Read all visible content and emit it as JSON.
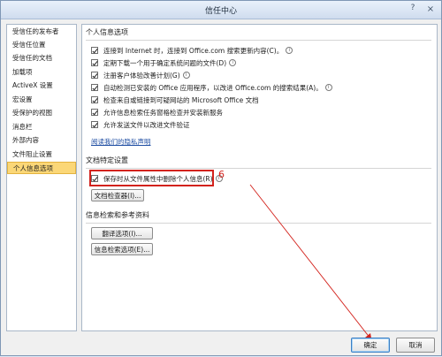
{
  "window": {
    "title": "信任中心",
    "help_label": "?",
    "close_label": "×"
  },
  "sidebar": {
    "items": [
      {
        "label": "受信任的发布者"
      },
      {
        "label": "受信任位置"
      },
      {
        "label": "受信任的文档"
      },
      {
        "label": "加载项"
      },
      {
        "label": "ActiveX 设置"
      },
      {
        "label": "宏设置"
      },
      {
        "label": "受保护的视图"
      },
      {
        "label": "消息栏"
      },
      {
        "label": "外部内容"
      },
      {
        "label": "文件阻止设置"
      },
      {
        "label": "个人信息选项"
      }
    ],
    "active_index": 10
  },
  "personal_info": {
    "heading": "个人信息选项",
    "options": [
      {
        "label": "连接到 Internet 时，连接到 Office.com 搜索更新内容(C)。",
        "checked": true
      },
      {
        "label": "定期下载一个用于确定系统问题的文件(D)",
        "checked": true
      },
      {
        "label": "注册客户体验改善计划(G)",
        "checked": true
      },
      {
        "label": "自动检测已安装的 Office 应用程序，以改进 Office.com 的搜索结果(A)。",
        "checked": true
      },
      {
        "label": "检查来自或链接到可疑网站的 Microsoft Office 文档",
        "checked": true
      },
      {
        "label": "允许信息检索任务窗格检查并安装新服务",
        "checked": true
      },
      {
        "label": "允许发送文件以改进文件验证",
        "checked": true
      }
    ],
    "privacy_link": "阅读我们的隐私声明"
  },
  "doc_settings": {
    "heading": "文档特定设置",
    "option": {
      "label": "保存时从文件属性中删除个人信息(R)",
      "checked": true
    },
    "inspector_button": "文档检查器(I)..."
  },
  "research": {
    "heading": "信息检索和参考资料",
    "translate_button": "翻译选项(I)...",
    "research_button": "信息检索选项(E)..."
  },
  "annotation": {
    "step_number": "6"
  },
  "footer": {
    "ok_label": "确定",
    "cancel_label": "取消"
  },
  "colors": {
    "annotation_red": "#d3221c",
    "active_item": "#fbd777"
  }
}
